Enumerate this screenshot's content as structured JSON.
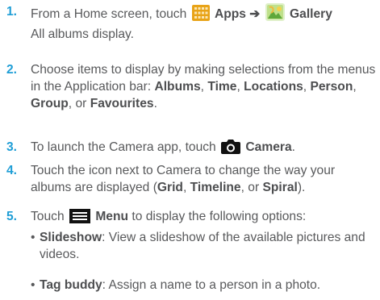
{
  "steps": [
    {
      "number": "1.",
      "s1_a": "From a Home screen, touch",
      "s1_apps": "Apps",
      "s1_arrow": "➔",
      "s1_gallery": "Gallery",
      "s1_b": "All albums display."
    },
    {
      "number": "2.",
      "a": "Choose items to display by making selections from the menus in the Application bar:",
      "albums": "Albums",
      "time": "Time",
      "locations": "Locations",
      "person": "Person",
      "group": "Group",
      "or": "or",
      "favourites": "Favourites",
      "sep": ",",
      "end": "."
    },
    {
      "number": "3.",
      "a": "To launch the Camera app, touch",
      "camera": "Camera",
      "end": "."
    },
    {
      "number": "4.",
      "a": "Touch the icon next to Camera to change the way your albums are displayed (",
      "grid": "Grid",
      "timeline": "Timeline",
      "or": "or",
      "spiral": "Spiral",
      "end": ")."
    },
    {
      "number": "5.",
      "a": "Touch",
      "menu": "Menu",
      "b": "to display the following options:"
    }
  ],
  "options": [
    {
      "label": "Slideshow",
      "desc": ": View a slideshow of the available pictures and videos."
    },
    {
      "label": "Tag buddy",
      "desc": ": Assign a name to a person in a photo."
    }
  ],
  "bullet": "•",
  "icons": [
    "apps-grid-icon",
    "gallery-icon",
    "camera-icon",
    "menu-icon"
  ],
  "colors": {
    "step_number": "#1f9ed6",
    "text": "#58595b",
    "apps_icon": "#e8a317",
    "gallery_icon": "#7fc241"
  }
}
